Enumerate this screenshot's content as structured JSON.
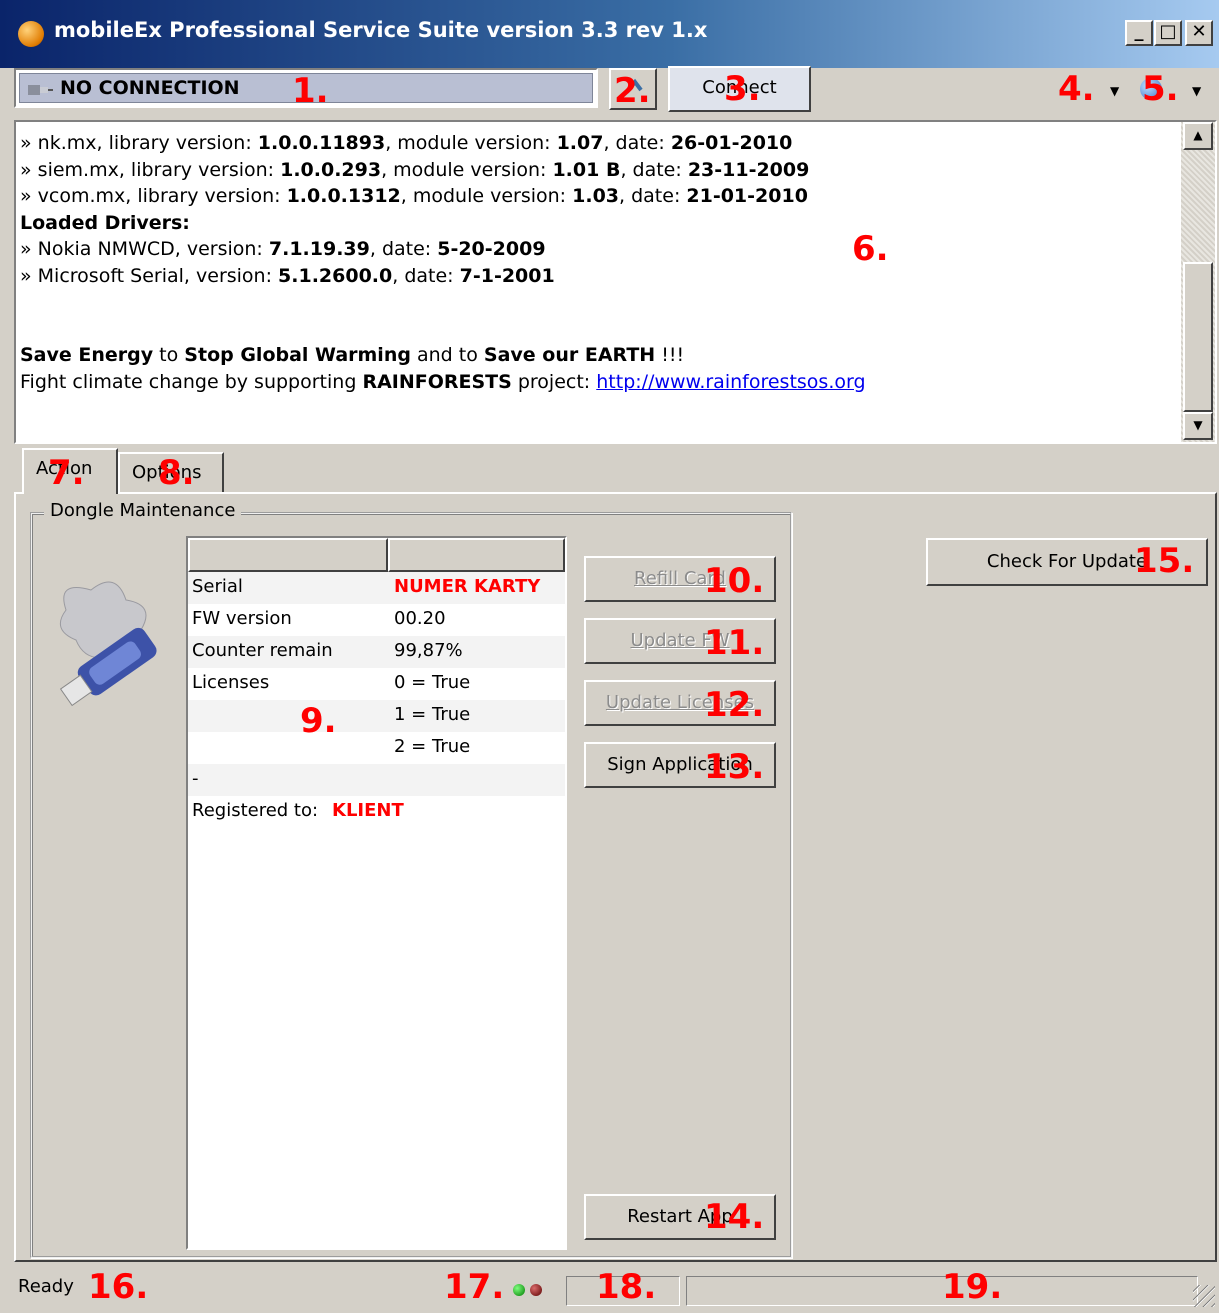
{
  "window": {
    "title": "mobileEx Professional Service Suite version 3.3 rev 1.x",
    "controls": {
      "minimize": "_",
      "maximize": "□",
      "close": "✕"
    }
  },
  "toolbar": {
    "connection_status": "NO CONNECTION",
    "connect_label": "Connect"
  },
  "log": {
    "lines": [
      {
        "prefix": "» nk.mx, library version: ",
        "lib": "1.0.0.11893",
        "mid": ", module version: ",
        "mod": "1.07",
        "dlabel": ", date: ",
        "date": "26-01-2010"
      },
      {
        "prefix": "» siem.mx, library version: ",
        "lib": "1.0.0.293",
        "mid": ", module version: ",
        "mod": "1.01 B",
        "dlabel": ", date: ",
        "date": "23-11-2009"
      },
      {
        "prefix": "» vcom.mx, library version: ",
        "lib": "1.0.0.1312",
        "mid": ", module version: ",
        "mod": "1.03",
        "dlabel": ", date: ",
        "date": "21-01-2010"
      }
    ],
    "drivers_heading": "Loaded Drivers:",
    "drivers": [
      {
        "prefix": "» Nokia NMWCD, version: ",
        "ver": "7.1.19.39",
        "dlabel": ", date: ",
        "date": "5-20-2009"
      },
      {
        "prefix": "» Microsoft Serial, version: ",
        "ver": "5.1.2600.0",
        "dlabel": ", date: ",
        "date": "7-1-2001"
      }
    ],
    "slogan": {
      "a": "Save Energy",
      "b": " to ",
      "c": "Stop Global Warming",
      "d": " and to ",
      "e": "Save our EARTH",
      "f": " !!!"
    },
    "rainforest": {
      "a": "Fight climate change by supporting ",
      "b": "RAINFORESTS",
      "c": " project: ",
      "link": "http://www.rainforestsos.org"
    }
  },
  "tabs": [
    {
      "label": "Action"
    },
    {
      "label": "Options"
    }
  ],
  "dongle": {
    "group_title": "Dongle Maintenance",
    "rows": [
      {
        "label": "Serial",
        "value": "NUMER KARTY"
      },
      {
        "label": "FW version",
        "value": "00.20"
      },
      {
        "label": "Counter remain",
        "value": "99,87%"
      },
      {
        "label": "Licenses",
        "value": "0 = True"
      },
      {
        "label": "",
        "value": "1 = True"
      },
      {
        "label": "",
        "value": "2 = True"
      },
      {
        "label": "-",
        "value": ""
      },
      {
        "label": "Registered to:",
        "value": "KLIENT"
      }
    ],
    "buttons": {
      "refill": "Refill Card",
      "update_fw": "Update FW",
      "update_licenses": "Update Licenses",
      "sign_app": "Sign Application",
      "restart_app": "Restart App"
    }
  },
  "check_update_label": "Check For Update",
  "status": {
    "text": "Ready"
  },
  "markers": [
    "1.",
    "2.",
    "3.",
    "4.",
    "5.",
    "6.",
    "7.",
    "8.",
    "9.",
    "10.",
    "11.",
    "12.",
    "13.",
    "14.",
    "15.",
    "16.",
    "17.",
    "18.",
    "19."
  ]
}
